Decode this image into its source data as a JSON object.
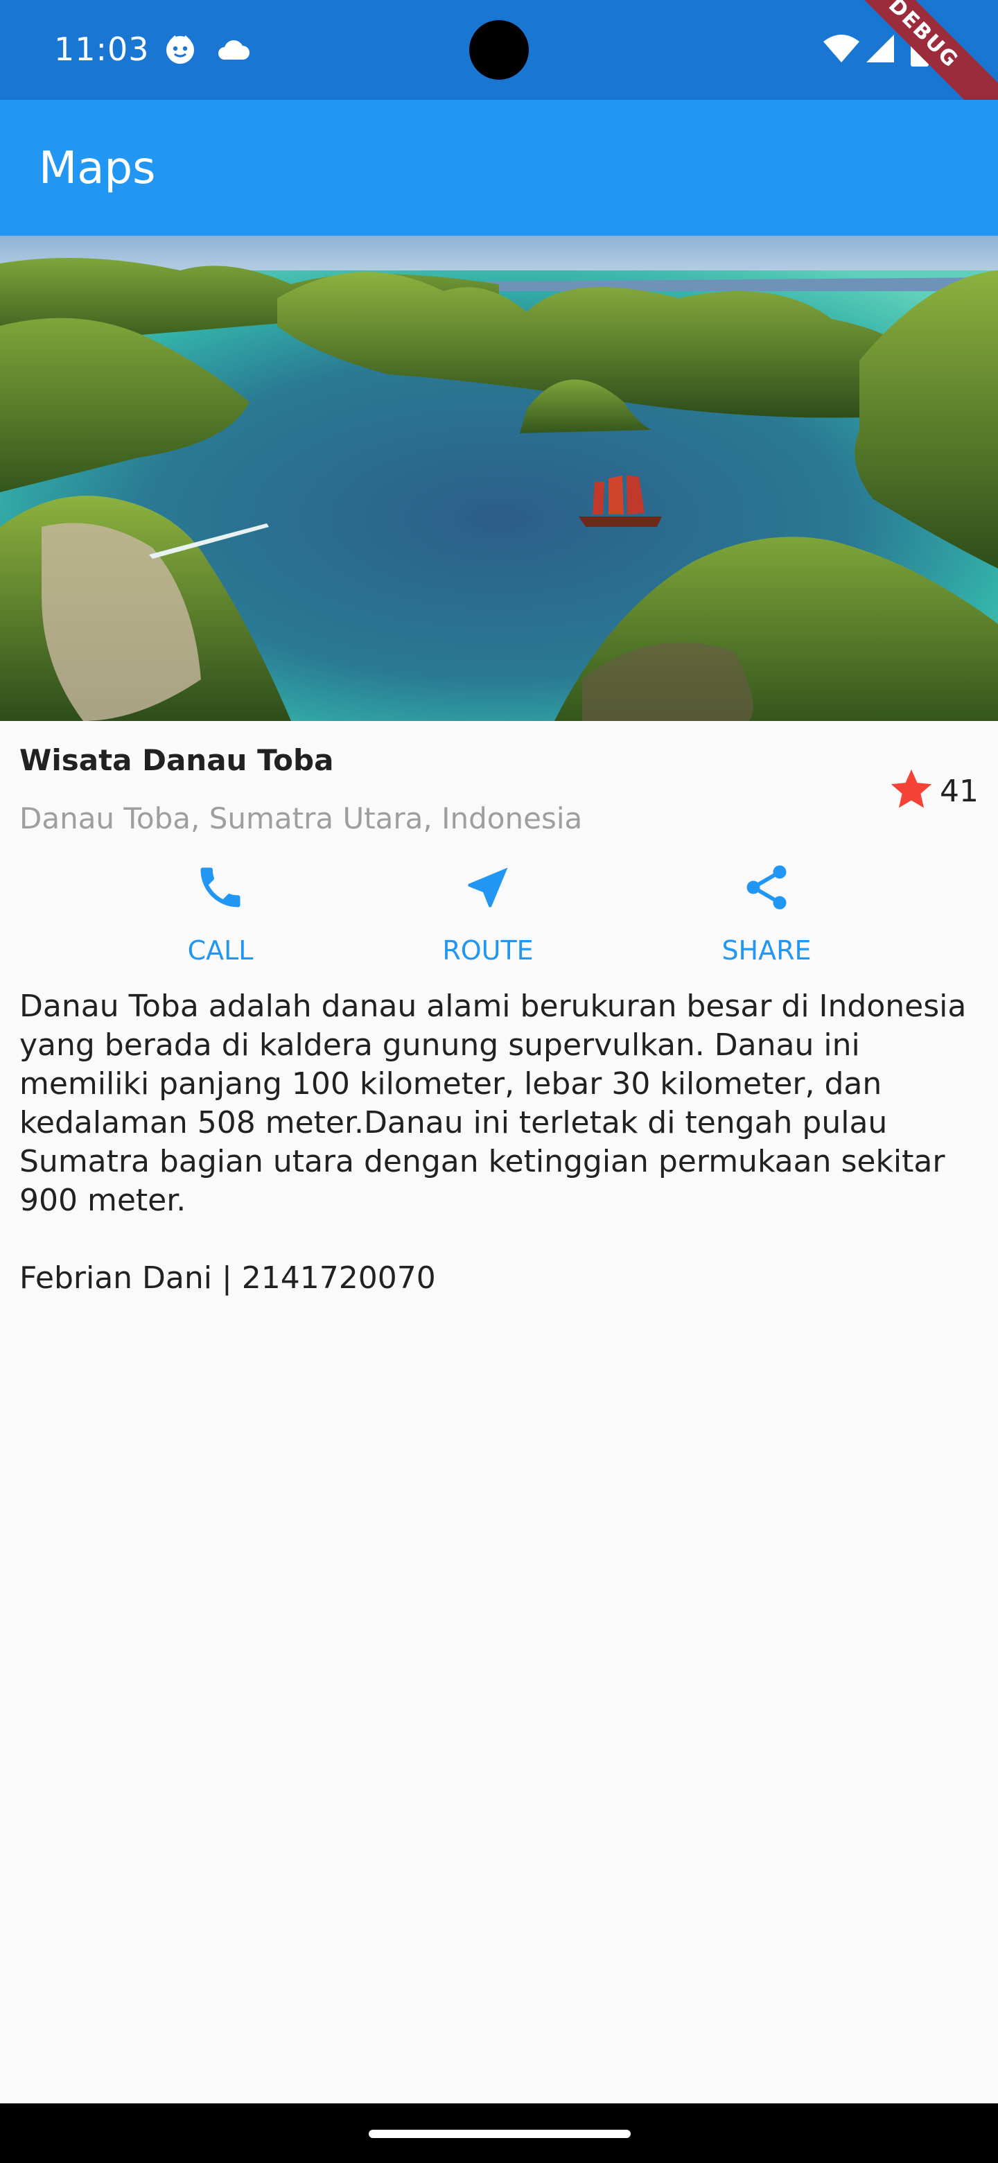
{
  "status_bar": {
    "time": "11:03",
    "icons": [
      "face-notification-icon",
      "cloud-icon",
      "wifi-icon",
      "signal-icon",
      "battery-icon"
    ],
    "debug_label": "DEBUG"
  },
  "app_bar": {
    "title": "Maps"
  },
  "hero": {
    "image_subject": "islands-lagoon-photo"
  },
  "place": {
    "title": "Wisata Danau Toba",
    "location": "Danau Toba, Sumatra Utara, Indonesia",
    "rating_count": "41",
    "star_color": "#f44336"
  },
  "actions": [
    {
      "label": "CALL",
      "icon": "phone-icon"
    },
    {
      "label": "ROUTE",
      "icon": "navigation-icon"
    },
    {
      "label": "SHARE",
      "icon": "share-icon"
    }
  ],
  "accent_color": "#2196f3",
  "description": "Danau Toba adalah danau alami berukuran besar di Indonesia yang berada di kaldera gunung supervulkan. Danau ini memiliki panjang 100 kilometer, lebar 30 kilometer, dan kedalaman 508 meter.Danau ini terletak di tengah pulau Sumatra bagian utara dengan ketinggian permukaan sekitar 900 meter.\n\nFebrian Dani | 2141720070"
}
